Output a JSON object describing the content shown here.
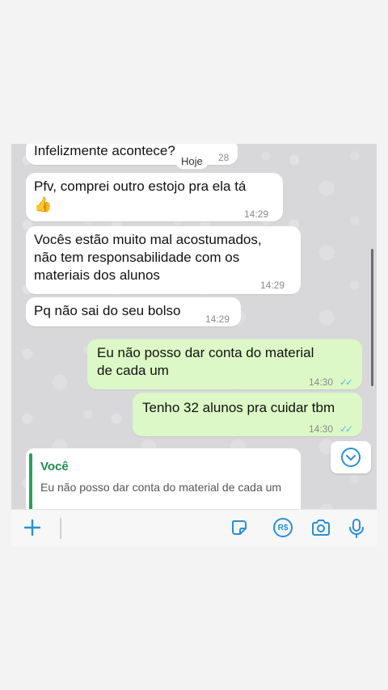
{
  "chat": {
    "date_chip": "Hoje",
    "messages": [
      {
        "text": "Infelizmente acontece?",
        "time": "28"
      },
      {
        "text": "Pfv, comprei outro estojo pra ela tá",
        "emoji": "👍",
        "time": "14:29"
      },
      {
        "text": "Vocês estão muito mal acostumados,\nnão tem responsabilidade com os\nmateriais dos alunos",
        "time": "14:29"
      },
      {
        "text": "Pq não sai do seu bolso",
        "time": "14:29"
      },
      {
        "text": "Eu não posso dar conta do material\nde cada um",
        "time": "14:30",
        "status": "read"
      },
      {
        "text": "Tenho 32 alunos pra cuidar tbm",
        "time": "14:30",
        "status": "read"
      }
    ],
    "tick_glyph": "✓✓",
    "colors": {
      "incoming": "#ffffff",
      "outgoing": "#dcf8c6",
      "read_ticks": "#53bdeb",
      "accent": "#1d8a4b"
    }
  },
  "reply": {
    "sender": "Você",
    "quoted_text": "Eu não posso dar conta do material de cada um"
  },
  "input_bar": {
    "icons": [
      "plus-icon",
      "sticker-icon",
      "payment-icon",
      "camera-icon",
      "microphone-icon"
    ],
    "payment_label": "R$"
  }
}
